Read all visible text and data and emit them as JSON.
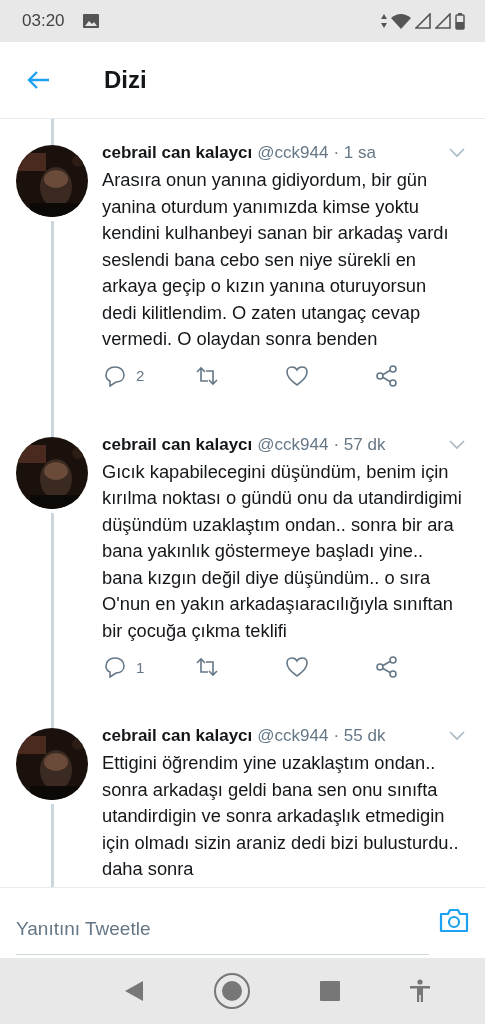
{
  "status_bar": {
    "time": "03:20"
  },
  "header": {
    "title": "Dizi"
  },
  "tweets": [
    {
      "name": "cebrail can kalaycı",
      "handle": "@cck944",
      "time": "· 1 sa",
      "text": "Arasıra onun yanına gidiyordum, bir gün yanina oturdum yanımızda kimse yoktu kendini kulhanbeyi sanan bir arkadaş vardı seslendi bana cebo sen niye sürekli en arkaya geçip o kızın yanına oturuyorsun dedi kilitlendim. O zaten utangaç cevap vermedi. O olaydan sonra benden",
      "replies": "2"
    },
    {
      "name": "cebrail can kalaycı",
      "handle": "@cck944",
      "time": "· 57 dk",
      "text": "Gıcık kapabilecegini düşündüm, benim için kırılma noktası o gündü  onu da utandirdigimi düşündüm uzaklaştım ondan.. sonra bir ara bana yakınlık göstermeye başladı yine.. bana kızgın değil diye düşündüm.. o sıra O'nun en yakın arkadaşıaracılığıyla sınıftan bir çocuğa çıkma teklifi",
      "replies": "1"
    },
    {
      "name": "cebrail can kalaycı",
      "handle": "@cck944",
      "time": "· 55 dk",
      "text": "Ettigini öğrendim yine uzaklaştım ondan.. sonra arkadaşı geldi bana sen onu sınıfta utandirdigin ve sonra arkadaşlık etmedigin için olmadı sizin araniz dedi bizi bulusturdu.. daha sonra"
    }
  ],
  "reply_bar": {
    "placeholder": "Yanıtını Tweetle"
  }
}
